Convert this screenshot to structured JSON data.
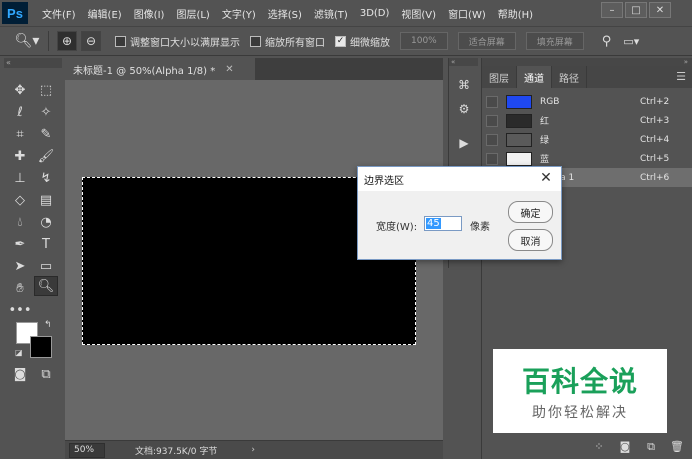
{
  "app": {
    "logo": "Ps",
    "menu": [
      "文件(F)",
      "编辑(E)",
      "图像(I)",
      "图层(L)",
      "文字(Y)",
      "选择(S)",
      "滤镜(T)",
      "3D(D)",
      "视图(V)",
      "窗口(W)",
      "帮助(H)"
    ]
  },
  "options": {
    "fit_window_label": "调整窗口大小以满屏显示",
    "zoom_all_label": "缩放所有窗口",
    "scrubby_zoom_label": "细微缩放",
    "btn_100": "100%",
    "btn_fit_screen": "适合屏幕",
    "btn_fill_screen": "填充屏幕"
  },
  "document": {
    "tab_title": "未标题-1 @ 50%(Alpha 1/8) *",
    "zoom": "50%",
    "info": "文档:937.5K/0 字节"
  },
  "panel": {
    "tabs": [
      "图层",
      "通道",
      "路径"
    ],
    "active_tab": "通道",
    "channels": [
      {
        "name": "RGB",
        "key": "Ctrl+2",
        "color": "#1f48f0"
      },
      {
        "name": "红",
        "key": "Ctrl+3",
        "color": "#2a2a2a"
      },
      {
        "name": "绿",
        "key": "Ctrl+4",
        "color": "#5a5a5a"
      },
      {
        "name": "蓝",
        "key": "Ctrl+5",
        "color": "#f2f2f2"
      },
      {
        "name": "Alpha 1",
        "key": "Ctrl+6",
        "color": "#111111"
      }
    ]
  },
  "dialog": {
    "title": "边界选区",
    "width_label": "宽度(W):",
    "width_value": "45",
    "unit": "像素",
    "ok": "确定",
    "cancel": "取消"
  },
  "watermark": {
    "main": "百科全说",
    "sub": "助你轻松解决"
  }
}
